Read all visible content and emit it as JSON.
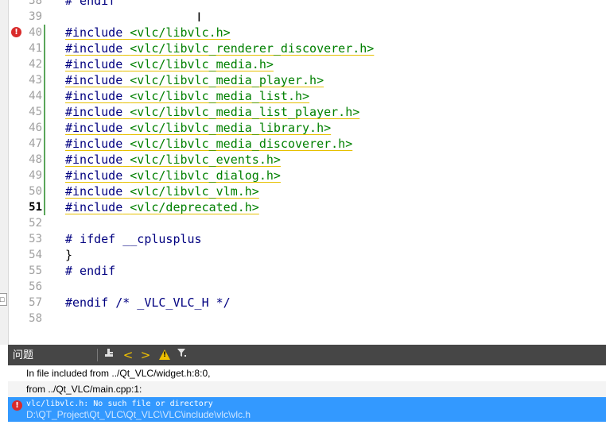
{
  "editor": {
    "lines": [
      {
        "num": "38",
        "code": "# endif",
        "kind": "directive"
      },
      {
        "num": "39",
        "code": "",
        "kind": "blank"
      },
      {
        "num": "40",
        "kw": "#include",
        "arg": "<vlc/libvlc.h>",
        "kind": "include",
        "error": true
      },
      {
        "num": "41",
        "kw": "#include",
        "arg": "<vlc/libvlc_renderer_discoverer.h>",
        "kind": "include"
      },
      {
        "num": "42",
        "kw": "#include",
        "arg": "<vlc/libvlc_media.h>",
        "kind": "include"
      },
      {
        "num": "43",
        "kw": "#include",
        "arg": "<vlc/libvlc_media_player.h>",
        "kind": "include"
      },
      {
        "num": "44",
        "kw": "#include",
        "arg": "<vlc/libvlc_media_list.h>",
        "kind": "include"
      },
      {
        "num": "45",
        "kw": "#include",
        "arg": "<vlc/libvlc_media_list_player.h>",
        "kind": "include"
      },
      {
        "num": "46",
        "kw": "#include",
        "arg": "<vlc/libvlc_media_library.h>",
        "kind": "include"
      },
      {
        "num": "47",
        "kw": "#include",
        "arg": "<vlc/libvlc_media_discoverer.h>",
        "kind": "include"
      },
      {
        "num": "48",
        "kw": "#include",
        "arg": "<vlc/libvlc_events.h>",
        "kind": "include"
      },
      {
        "num": "49",
        "kw": "#include",
        "arg": "<vlc/libvlc_dialog.h>",
        "kind": "include"
      },
      {
        "num": "50",
        "kw": "#include",
        "arg": "<vlc/libvlc_vlm.h>",
        "kind": "include"
      },
      {
        "num": "51",
        "kw": "#include",
        "arg": "<vlc/deprecated.h>",
        "kind": "include",
        "current": true
      },
      {
        "num": "52",
        "code": "",
        "kind": "blank"
      },
      {
        "num": "53",
        "code": "# ifdef __cplusplus",
        "kind": "directive"
      },
      {
        "num": "54",
        "code": "}",
        "kind": "plain"
      },
      {
        "num": "55",
        "code": "# endif",
        "kind": "directive"
      },
      {
        "num": "56",
        "code": "",
        "kind": "blank"
      },
      {
        "num": "57",
        "kw": "#endif",
        "arg": " /* _VLC_VLC_H */",
        "kind": "endif"
      },
      {
        "num": "58",
        "code": "",
        "kind": "blank"
      }
    ]
  },
  "issues_panel": {
    "title": "问题",
    "toolbar": {
      "build_icon": "build-filter-icon",
      "prev_label": "<",
      "next_label": ">",
      "warning_label": "!",
      "filter_label": "▼."
    },
    "rows": [
      {
        "text": "In file included from ../Qt_VLC/widget.h:8:0,"
      },
      {
        "text": "from ../Qt_VLC/main.cpp:1:"
      }
    ],
    "selected_error": {
      "message": "vlc/libvlc.h: No such file or directory",
      "path": "D:\\QT_Project\\Qt_VLC\\Qt_VLC\\VLC\\include\\vlc\\vlc.h"
    }
  },
  "colors": {
    "include_keyword": "#000080",
    "include_path": "#008000",
    "error": "#d92b2b",
    "selection": "#3399ff",
    "toolbar": "#464646"
  }
}
